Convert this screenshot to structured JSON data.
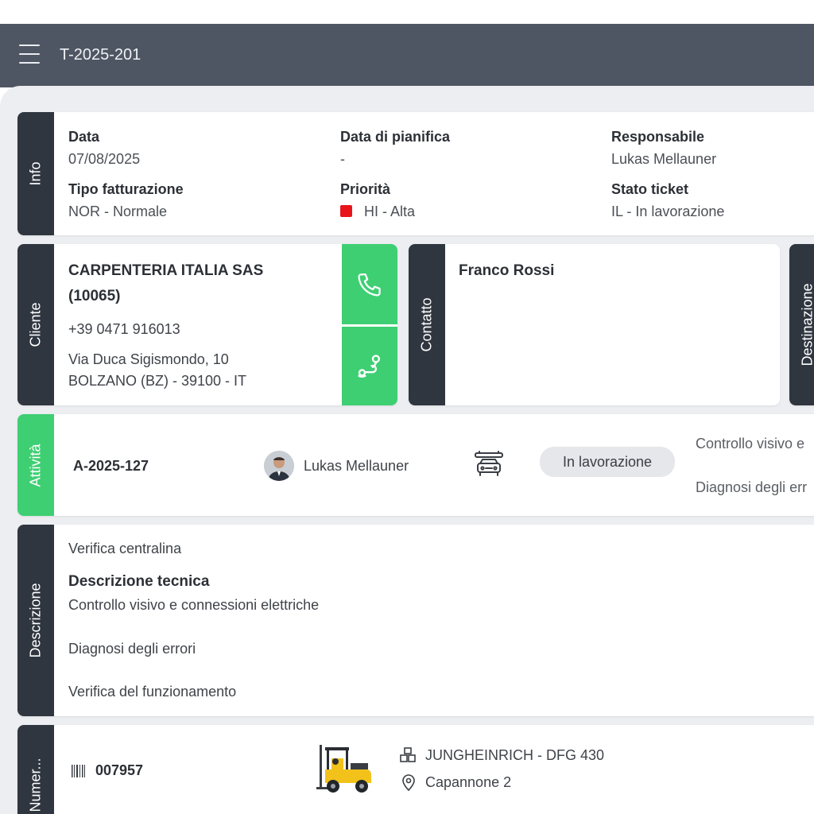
{
  "appbar": {
    "title": "T-2025-201"
  },
  "info": {
    "section_label": "Info",
    "data_label": "Data",
    "data_value": "07/08/2025",
    "pianifica_label": "Data di pianifica",
    "pianifica_value": "-",
    "responsabile_label": "Responsabile",
    "responsabile_value": "Lukas Mellauner",
    "fatturazione_label": "Tipo fatturazione",
    "fatturazione_value": "NOR - Normale",
    "priorita_label": "Priorità",
    "priorita_value": "HI - Alta",
    "priorita_color": "#e8141b",
    "stato_label": "Stato ticket",
    "stato_value": "IL - In lavorazione"
  },
  "cliente": {
    "section_label": "Cliente",
    "name_line1": "CARPENTERIA ITALIA SAS",
    "name_line2": "(10065)",
    "phone": "+39 0471 916013",
    "address_line1": "Via Duca Sigismondo, 10",
    "address_line2": "BOLZANO (BZ) - 39100 - IT",
    "actions": {
      "call_icon": "phone-icon",
      "route_icon": "route-icon"
    }
  },
  "contatto": {
    "section_label": "Contatto",
    "name": "Franco Rossi"
  },
  "destinazione": {
    "section_label": "Destinazione"
  },
  "attivita": {
    "section_label": "Attività",
    "code": "A-2025-127",
    "assignee": "Lukas Mellauner",
    "vehicle_icon": "vehicle-service-icon",
    "status": "In lavorazione",
    "notes_line1": "Controllo visivo e",
    "notes_line2": "Diagnosi degli err"
  },
  "descrizione": {
    "section_label": "Descrizione",
    "summary": "Verifica centralina",
    "tech_title": "Descrizione tecnica",
    "tech_lines": [
      "Controllo visivo e connessioni elettriche",
      "Diagnosi degli errori",
      "Verifica del funzionamento"
    ]
  },
  "matricola": {
    "section_label": "Numer...",
    "serial": "007957",
    "model": "JUNGHEINRICH - DFG 430",
    "location": "Capannone 2"
  },
  "colors": {
    "appbar": "#4f5663",
    "side_dark": "#2f3640",
    "accent_green": "#3ecf73",
    "background": "#eceef1"
  }
}
